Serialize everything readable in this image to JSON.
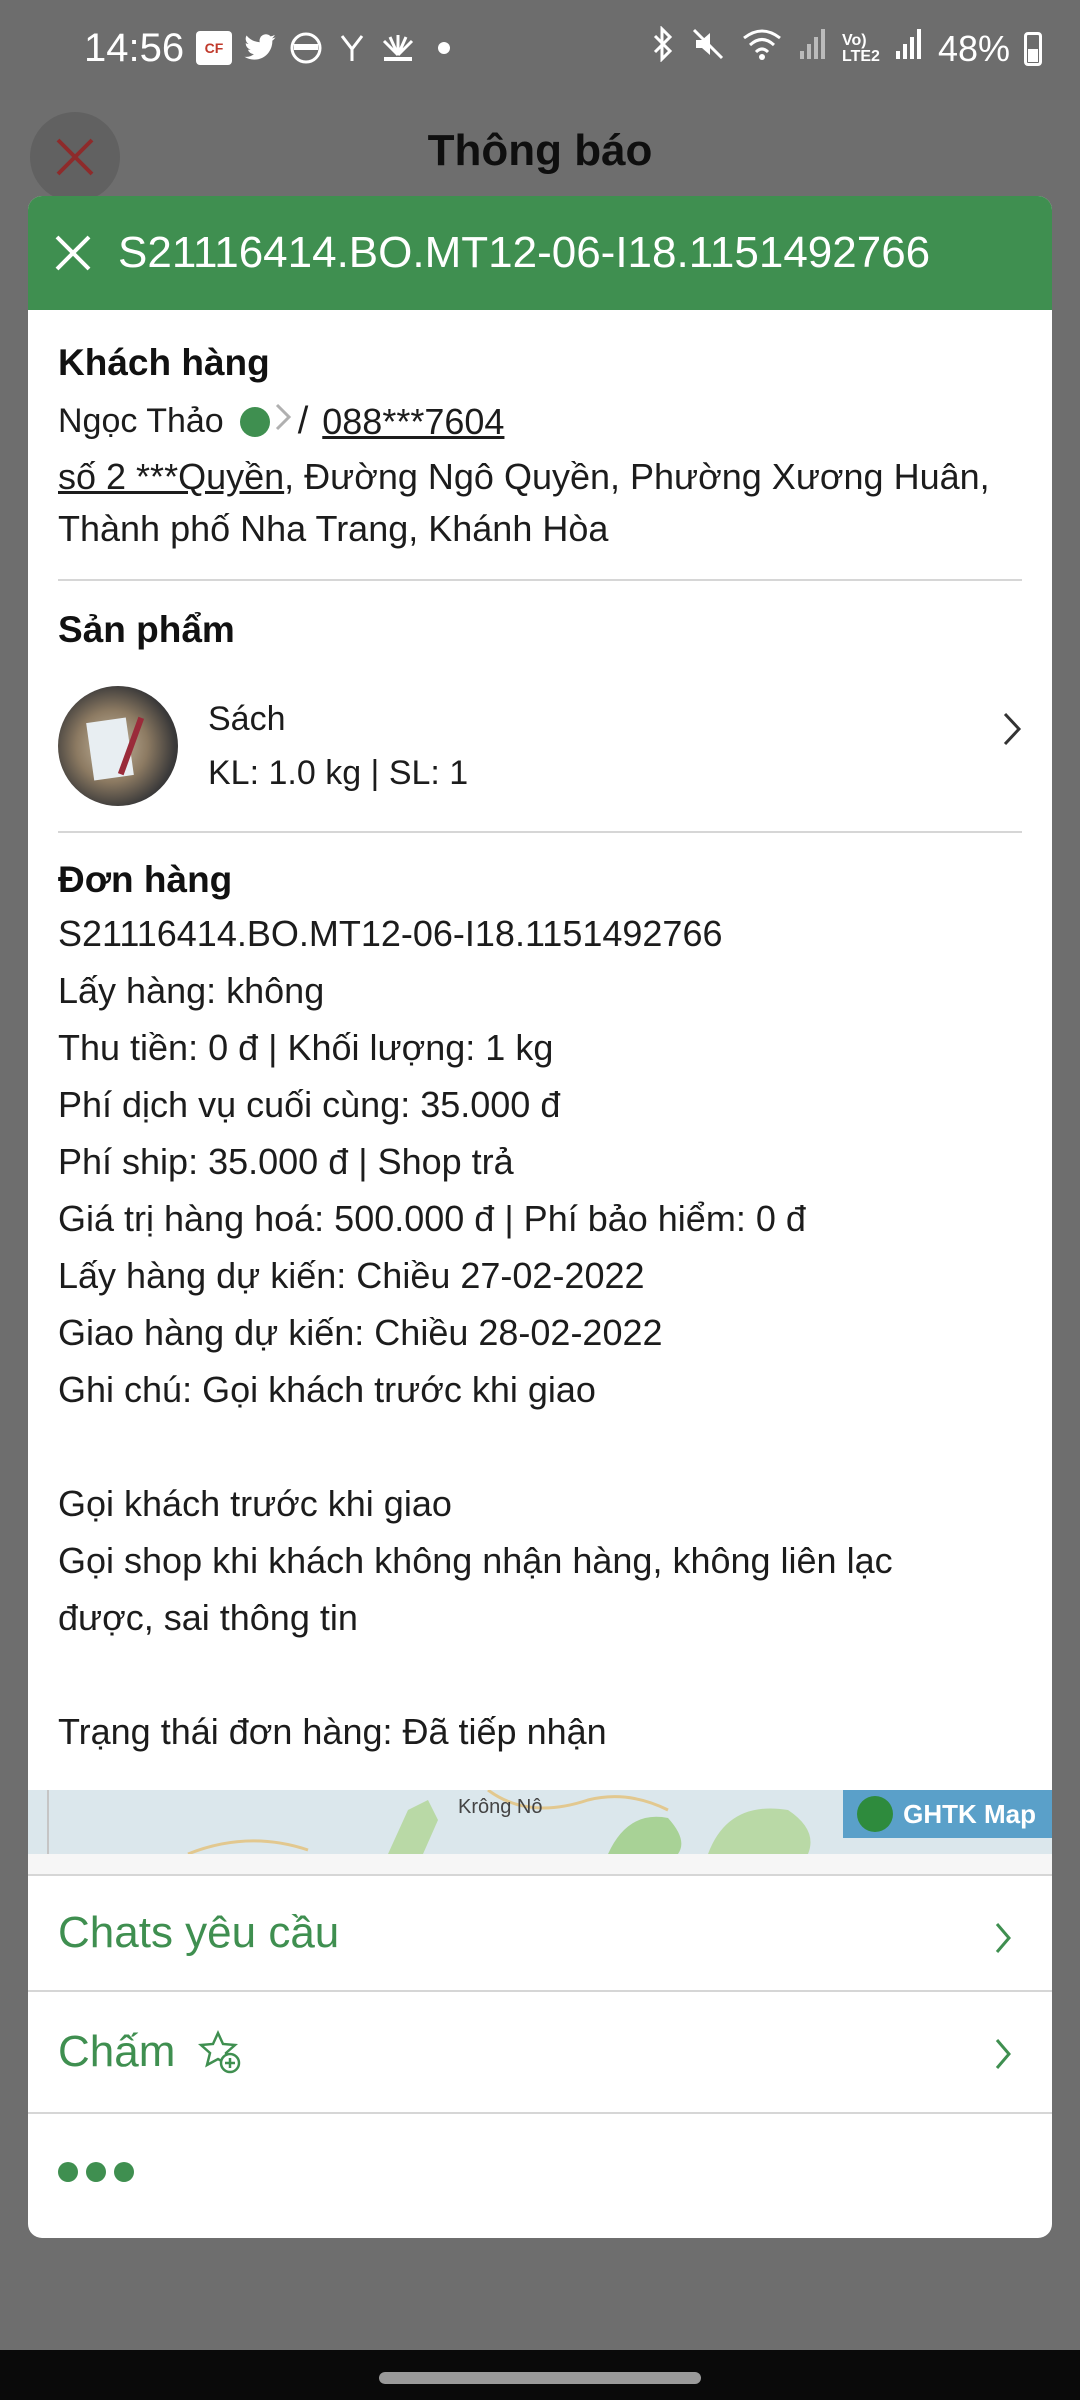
{
  "status_bar": {
    "time": "14:56",
    "battery": "48%",
    "icons": [
      "cf-app-icon",
      "twitter-icon",
      "brave-icon",
      "y-icon",
      "cnbc-icon",
      "dot-icon",
      "bluetooth-icon",
      "mute-icon",
      "wifi-icon",
      "signal-icon",
      "volte-icon",
      "signal-icon",
      "battery-icon"
    ]
  },
  "background_header": {
    "title": "Thông báo"
  },
  "modal": {
    "order_code": "S21116414.BO.MT12-06-I18.1151492766",
    "customer": {
      "title": "Khách hàng",
      "name": "Ngọc Thảo",
      "separator": "/",
      "phone": "088***7604",
      "address_link": "số 2 ***Quyền",
      "address_rest": ", Đường Ngô Quyền, Phường Xương Huân, Thành phố Nha Trang, Khánh Hòa"
    },
    "product": {
      "title": "Sản phẩm",
      "name": "Sách",
      "details": "KL: 1.0 kg | SL: 1"
    },
    "order": {
      "title": "Đơn hàng",
      "lines": [
        "S21116414.BO.MT12-06-I18.1151492766",
        "Lấy hàng: không",
        "Thu tiền: 0 đ | Khối lượng: 1 kg",
        "Phí dịch vụ cuối cùng: 35.000 đ",
        "Phí ship: 35.000 đ | Shop trả",
        "Giá trị hàng hoá: 500.000 đ | Phí bảo hiểm: 0 đ",
        "Lấy hàng dự kiến: Chiều 27-02-2022",
        "Giao hàng dự kiến: Chiều 28-02-2022",
        "Ghi chú: Gọi khách trước khi giao"
      ],
      "note_lines": [
        "Gọi khách trước khi giao",
        "Gọi shop khi khách không nhận hàng, không liên lạc",
        "được, sai thông tin"
      ],
      "status_line": "Trạng thái đơn hàng: Đã tiếp nhận"
    },
    "map": {
      "place_label": "Krông Nô",
      "brand_label": "GHTK Map"
    },
    "menu": {
      "chats_label": "Chats yêu cầu",
      "rate_label": "Chấm"
    },
    "colors": {
      "accent": "#3f8f50"
    }
  }
}
